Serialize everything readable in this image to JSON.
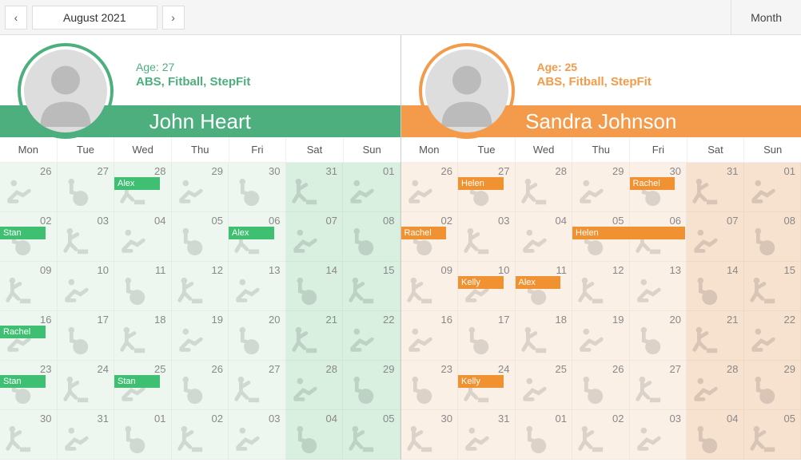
{
  "toolbar": {
    "date_label": "August 2021",
    "prev_glyph": "‹",
    "next_glyph": "›",
    "view_label": "Month"
  },
  "dow": [
    "Mon",
    "Tue",
    "Wed",
    "Thu",
    "Fri",
    "Sat",
    "Sun"
  ],
  "trainers": [
    {
      "key": "john",
      "color": "green",
      "name": "John Heart",
      "age_label": "Age: 27",
      "programs": "ABS, Fitball, StepFit",
      "days": [
        {
          "num": "26",
          "weekend": false,
          "icon": "abs",
          "appt": null
        },
        {
          "num": "27",
          "weekend": false,
          "icon": "fitball",
          "appt": null
        },
        {
          "num": "28",
          "weekend": false,
          "icon": "step",
          "appt": "Alex"
        },
        {
          "num": "29",
          "weekend": false,
          "icon": "abs",
          "appt": null
        },
        {
          "num": "30",
          "weekend": false,
          "icon": "fitball",
          "appt": null
        },
        {
          "num": "31",
          "weekend": true,
          "icon": "step",
          "appt": null
        },
        {
          "num": "01",
          "weekend": true,
          "icon": "abs",
          "appt": null
        },
        {
          "num": "02",
          "weekend": false,
          "icon": "fitball",
          "appt": "Stan"
        },
        {
          "num": "03",
          "weekend": false,
          "icon": "step",
          "appt": null
        },
        {
          "num": "04",
          "weekend": false,
          "icon": "abs",
          "appt": null
        },
        {
          "num": "05",
          "weekend": false,
          "icon": "fitball",
          "appt": null
        },
        {
          "num": "06",
          "weekend": false,
          "icon": "step",
          "appt": "Alex"
        },
        {
          "num": "07",
          "weekend": true,
          "icon": "abs",
          "appt": null
        },
        {
          "num": "08",
          "weekend": true,
          "icon": "fitball",
          "appt": null
        },
        {
          "num": "09",
          "weekend": false,
          "icon": "step",
          "appt": null
        },
        {
          "num": "10",
          "weekend": false,
          "icon": "abs",
          "appt": null
        },
        {
          "num": "11",
          "weekend": false,
          "icon": "fitball",
          "appt": null
        },
        {
          "num": "12",
          "weekend": false,
          "icon": "step",
          "appt": null
        },
        {
          "num": "13",
          "weekend": false,
          "icon": "abs",
          "appt": null
        },
        {
          "num": "14",
          "weekend": true,
          "icon": "fitball",
          "appt": null
        },
        {
          "num": "15",
          "weekend": true,
          "icon": "step",
          "appt": null
        },
        {
          "num": "16",
          "weekend": false,
          "icon": "abs",
          "appt": "Rachel"
        },
        {
          "num": "17",
          "weekend": false,
          "icon": "fitball",
          "appt": null
        },
        {
          "num": "18",
          "weekend": false,
          "icon": "step",
          "appt": null
        },
        {
          "num": "19",
          "weekend": false,
          "icon": "abs",
          "appt": null
        },
        {
          "num": "20",
          "weekend": false,
          "icon": "fitball",
          "appt": null
        },
        {
          "num": "21",
          "weekend": true,
          "icon": "step",
          "appt": null
        },
        {
          "num": "22",
          "weekend": true,
          "icon": "abs",
          "appt": null
        },
        {
          "num": "23",
          "weekend": false,
          "icon": "fitball",
          "appt": "Stan"
        },
        {
          "num": "24",
          "weekend": false,
          "icon": "step",
          "appt": null
        },
        {
          "num": "25",
          "weekend": false,
          "icon": "abs",
          "appt": "Stan"
        },
        {
          "num": "26",
          "weekend": false,
          "icon": "fitball",
          "appt": null
        },
        {
          "num": "27",
          "weekend": false,
          "icon": "step",
          "appt": null
        },
        {
          "num": "28",
          "weekend": true,
          "icon": "abs",
          "appt": null
        },
        {
          "num": "29",
          "weekend": true,
          "icon": "fitball",
          "appt": null
        },
        {
          "num": "30",
          "weekend": false,
          "icon": "step",
          "appt": null
        },
        {
          "num": "31",
          "weekend": false,
          "icon": "abs",
          "appt": null
        },
        {
          "num": "01",
          "weekend": false,
          "icon": "fitball",
          "appt": null
        },
        {
          "num": "02",
          "weekend": false,
          "icon": "step",
          "appt": null
        },
        {
          "num": "03",
          "weekend": false,
          "icon": "abs",
          "appt": null
        },
        {
          "num": "04",
          "weekend": true,
          "icon": "fitball",
          "appt": null
        },
        {
          "num": "05",
          "weekend": true,
          "icon": "step",
          "appt": null
        }
      ]
    },
    {
      "key": "sandra",
      "color": "orange",
      "name": "Sandra Johnson",
      "age_label": "Age: 25",
      "programs": "ABS, Fitball, StepFit",
      "days": [
        {
          "num": "26",
          "weekend": false,
          "icon": "abs",
          "appt": null
        },
        {
          "num": "27",
          "weekend": false,
          "icon": "fitball",
          "appt": "Helen"
        },
        {
          "num": "28",
          "weekend": false,
          "icon": "step",
          "appt": null
        },
        {
          "num": "29",
          "weekend": false,
          "icon": "abs",
          "appt": null
        },
        {
          "num": "30",
          "weekend": false,
          "icon": "fitball",
          "appt": "Rachel"
        },
        {
          "num": "31",
          "weekend": true,
          "icon": "step",
          "appt": null
        },
        {
          "num": "01",
          "weekend": true,
          "icon": "abs",
          "appt": null
        },
        {
          "num": "02",
          "weekend": false,
          "icon": "fitball",
          "appt": "Rachel"
        },
        {
          "num": "03",
          "weekend": false,
          "icon": "step",
          "appt": null
        },
        {
          "num": "04",
          "weekend": false,
          "icon": "abs",
          "appt": null
        },
        {
          "num": "05",
          "weekend": false,
          "icon": "fitball",
          "appt": "Helen",
          "full": true
        },
        {
          "num": "06",
          "weekend": false,
          "icon": "step",
          "appt": null,
          "covered": true
        },
        {
          "num": "07",
          "weekend": true,
          "icon": "abs",
          "appt": null
        },
        {
          "num": "08",
          "weekend": true,
          "icon": "fitball",
          "appt": null
        },
        {
          "num": "09",
          "weekend": false,
          "icon": "step",
          "appt": null
        },
        {
          "num": "10",
          "weekend": false,
          "icon": "abs",
          "appt": "Kelly"
        },
        {
          "num": "11",
          "weekend": false,
          "icon": "fitball",
          "appt": "Alex"
        },
        {
          "num": "12",
          "weekend": false,
          "icon": "step",
          "appt": null
        },
        {
          "num": "13",
          "weekend": false,
          "icon": "abs",
          "appt": null
        },
        {
          "num": "14",
          "weekend": true,
          "icon": "fitball",
          "appt": null
        },
        {
          "num": "15",
          "weekend": true,
          "icon": "step",
          "appt": null
        },
        {
          "num": "16",
          "weekend": false,
          "icon": "abs",
          "appt": null
        },
        {
          "num": "17",
          "weekend": false,
          "icon": "fitball",
          "appt": null
        },
        {
          "num": "18",
          "weekend": false,
          "icon": "step",
          "appt": null
        },
        {
          "num": "19",
          "weekend": false,
          "icon": "abs",
          "appt": null
        },
        {
          "num": "20",
          "weekend": false,
          "icon": "fitball",
          "appt": null
        },
        {
          "num": "21",
          "weekend": true,
          "icon": "step",
          "appt": null
        },
        {
          "num": "22",
          "weekend": true,
          "icon": "abs",
          "appt": null
        },
        {
          "num": "23",
          "weekend": false,
          "icon": "fitball",
          "appt": null
        },
        {
          "num": "24",
          "weekend": false,
          "icon": "step",
          "appt": "Kelly"
        },
        {
          "num": "25",
          "weekend": false,
          "icon": "abs",
          "appt": null
        },
        {
          "num": "26",
          "weekend": false,
          "icon": "fitball",
          "appt": null
        },
        {
          "num": "27",
          "weekend": false,
          "icon": "step",
          "appt": null
        },
        {
          "num": "28",
          "weekend": true,
          "icon": "abs",
          "appt": null
        },
        {
          "num": "29",
          "weekend": true,
          "icon": "fitball",
          "appt": null
        },
        {
          "num": "30",
          "weekend": false,
          "icon": "step",
          "appt": null
        },
        {
          "num": "31",
          "weekend": false,
          "icon": "abs",
          "appt": null
        },
        {
          "num": "01",
          "weekend": false,
          "icon": "fitball",
          "appt": null
        },
        {
          "num": "02",
          "weekend": false,
          "icon": "step",
          "appt": null
        },
        {
          "num": "03",
          "weekend": false,
          "icon": "abs",
          "appt": null
        },
        {
          "num": "04",
          "weekend": true,
          "icon": "fitball",
          "appt": null
        },
        {
          "num": "05",
          "weekend": true,
          "icon": "step",
          "appt": null
        }
      ]
    }
  ]
}
